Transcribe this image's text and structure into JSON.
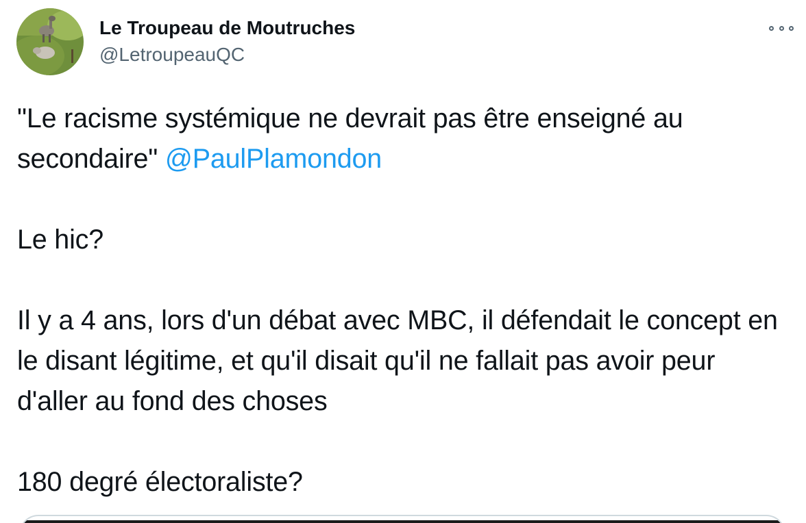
{
  "author": {
    "name": "Le Troupeau de Moutruches",
    "handle": "@LetroupeauQC"
  },
  "tweet": {
    "line1_before_mention": "\"Le racisme systémique ne devrait pas être enseigné au secondaire\" ",
    "mention": "@PaulPlamondon",
    "paragraph2": "Le hic?",
    "paragraph3": "Il y a 4 ans, lors d'un débat avec MBC, il défendait le concept en le disant légitime, et qu'il disait qu'il ne fallait pas avoir peur d'aller au fond des choses",
    "paragraph4": "180 degré électoraliste?"
  },
  "icons": {
    "more": "more-horizontal-icon",
    "avatar": "sheep-and-ostrich-photo"
  },
  "colors": {
    "text": "#0f1419",
    "secondary": "#536471",
    "link": "#1d9bf0",
    "border": "#cfd9de"
  }
}
